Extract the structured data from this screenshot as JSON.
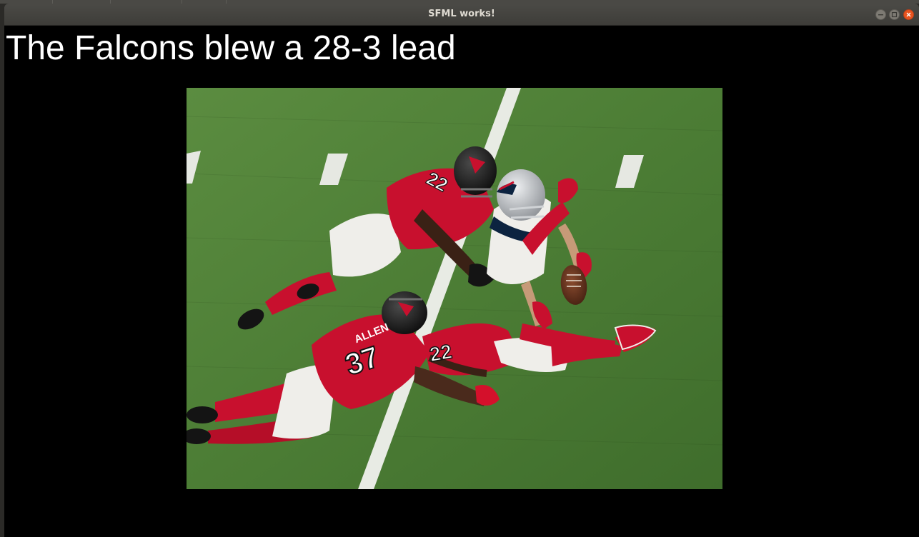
{
  "window": {
    "title": "SFML works!",
    "controls": {
      "minimize_icon": "minimize-icon",
      "maximize_icon": "maximize-icon",
      "close_icon": "close-icon"
    },
    "accent_color": "#e95420"
  },
  "canvas": {
    "background_color": "#000000",
    "headline": "The Falcons blew a 28-3 lead",
    "headline_color": "#ffffff"
  },
  "photo": {
    "jersey_number": "37",
    "jersey_name": "ALLEN",
    "colors": {
      "field": "#4e7f37",
      "falcons_red": "#c8102e",
      "helmet_black": "#1b1b1b",
      "patriots_silver": "#b9bcc0"
    }
  }
}
